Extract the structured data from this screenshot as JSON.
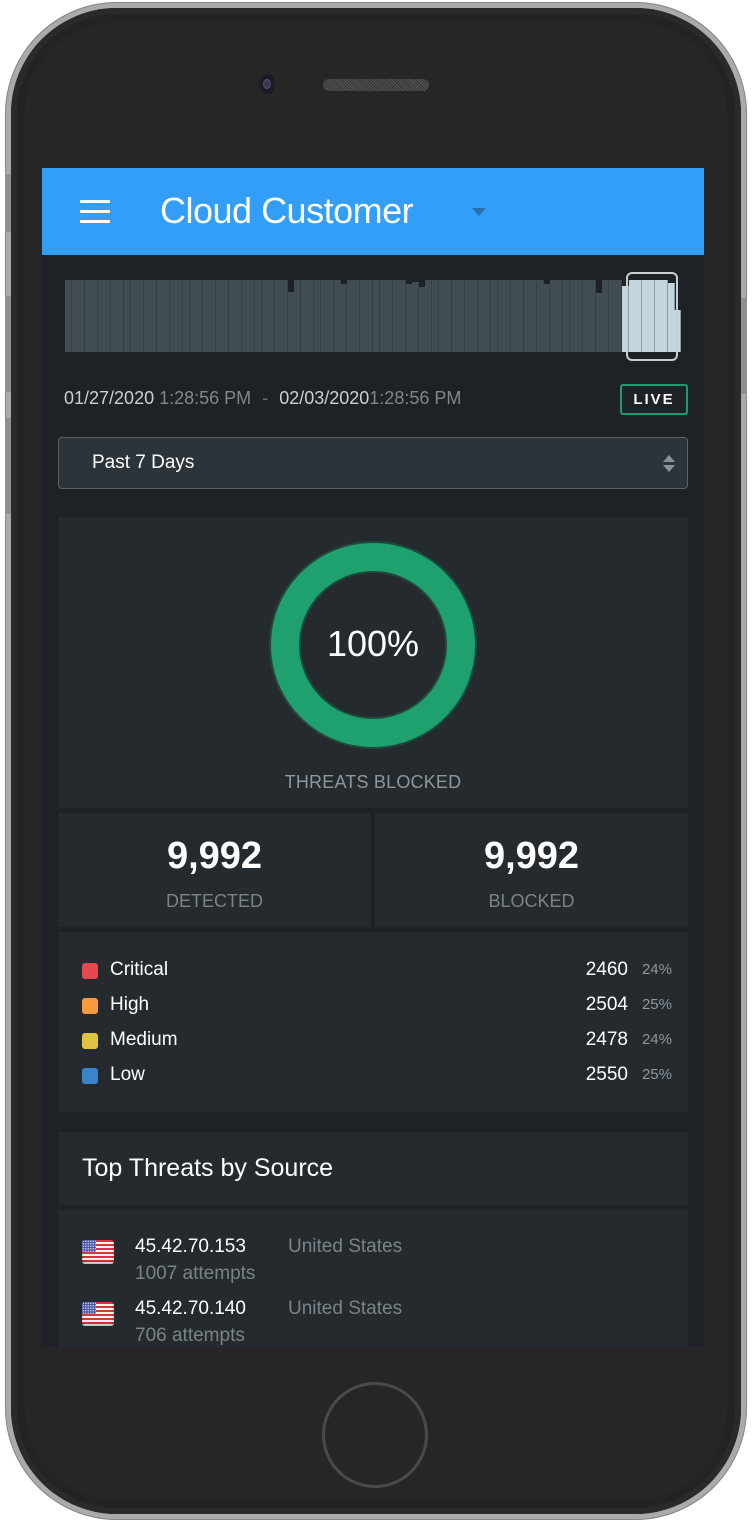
{
  "header": {
    "menu_icon": "hamburger-menu-icon",
    "title": "Cloud Customer",
    "title_dropdown_icon": "caret-down-icon"
  },
  "timeline": {
    "bar_levels": [
      1,
      1,
      1,
      1,
      1,
      1,
      1,
      1,
      1,
      1,
      1,
      1,
      1,
      1,
      1,
      1,
      1,
      1,
      1,
      1,
      1,
      1,
      1,
      1,
      1,
      1,
      1,
      1,
      1,
      1,
      1,
      1,
      1,
      1,
      0.84,
      1,
      1,
      1,
      1,
      1,
      1,
      1,
      0.95,
      1,
      1,
      1,
      1,
      1,
      1,
      1,
      1,
      1,
      0.95,
      0.97,
      0.9,
      1,
      1,
      1,
      1,
      1,
      1,
      1,
      1,
      1,
      1,
      1,
      1,
      1,
      1,
      1,
      1,
      1,
      1,
      0.95,
      1,
      1,
      1,
      1,
      1,
      1,
      1,
      0.82,
      1,
      1,
      1,
      0.91,
      1,
      1,
      1,
      1,
      1,
      1,
      0.96,
      0.58
    ],
    "selected_from_index": 85
  },
  "date_range": {
    "start_date": "01/27/2020",
    "start_time": "1:28:56 PM",
    "separator": "-",
    "end_date": "02/03/2020",
    "end_time": "1:28:56 PM",
    "live_label": "LIVE"
  },
  "period_select": {
    "value": "Past 7 Days"
  },
  "threats_blocked": {
    "percent": 100,
    "value_label": "100%",
    "label": "THREATS BLOCKED",
    "color": "#1fa06f"
  },
  "stats": [
    {
      "value": "9,992",
      "label": "DETECTED"
    },
    {
      "value": "9,992",
      "label": "BLOCKED"
    }
  ],
  "severity": [
    {
      "name": "Critical",
      "count": "2460",
      "percent": "24%",
      "color": "#e5484d"
    },
    {
      "name": "High",
      "count": "2504",
      "percent": "25%",
      "color": "#f79a3e"
    },
    {
      "name": "Medium",
      "count": "2478",
      "percent": "24%",
      "color": "#e0c340"
    },
    {
      "name": "Low",
      "count": "2550",
      "percent": "25%",
      "color": "#3a84c9"
    }
  ],
  "top_threats": {
    "title": "Top Threats by Source",
    "sources": [
      {
        "ip": "45.42.70.153",
        "country": "United States",
        "flag": "us-flag-icon",
        "attempts": "1007 attempts"
      },
      {
        "ip": "45.42.70.140",
        "country": "United States",
        "flag": "us-flag-icon",
        "attempts": "706 attempts"
      }
    ]
  }
}
